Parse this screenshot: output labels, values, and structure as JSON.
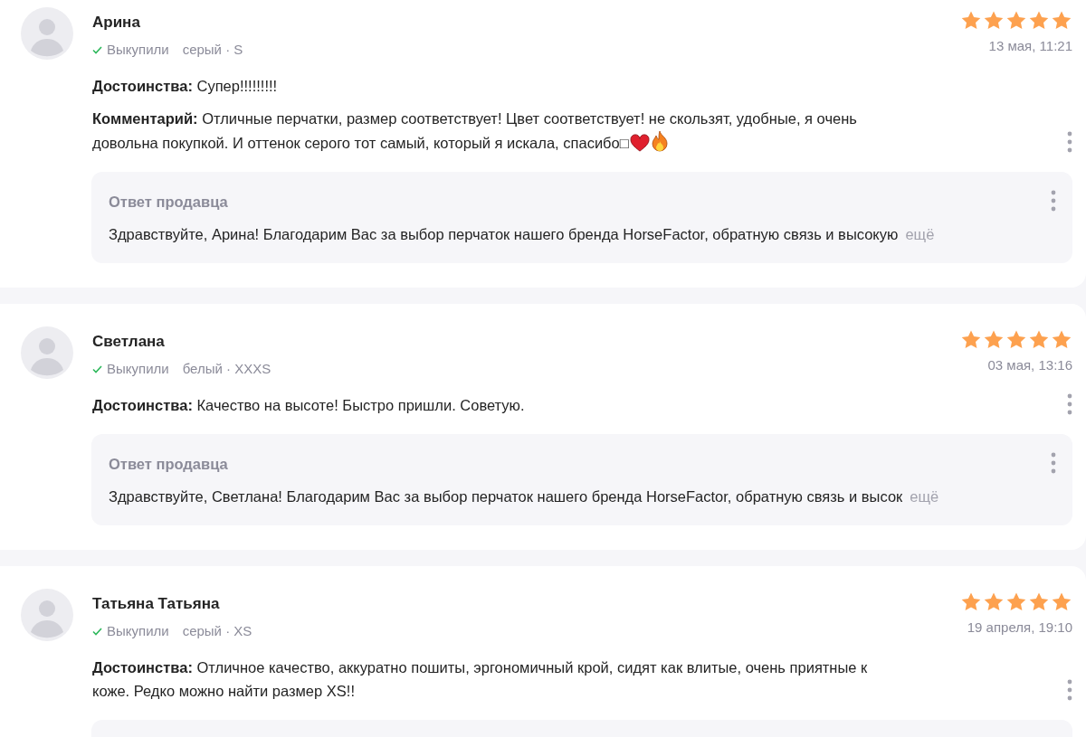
{
  "reviews": [
    {
      "author": "Арина",
      "purchase_status": "Выкупили",
      "variant": "серый · S",
      "stars": 5,
      "date": "13 мая, 11:21",
      "fields": [
        {
          "label": "Достоинства:",
          "text": "Супер!!!!!!!!!"
        },
        {
          "label": "Комментарий:",
          "text": "Отличные перчатки, размер соответствует! Цвет соответствует! не скользят, удобные, я очень довольна покупкой. И оттенок серого тот самый, который я искала, спасибо□",
          "emoji_icons": [
            {
              "kind": "heart"
            },
            {
              "kind": "fire"
            }
          ]
        }
      ],
      "reply": {
        "title": "Ответ продавца",
        "text": "Здравствуйте, Арина! Благодарим Вас за выбор перчаток нашего бренда HorseFactor, обратную связь и высокую",
        "more": "ещё"
      }
    },
    {
      "author": "Светлана",
      "purchase_status": "Выкупили",
      "variant": "белый · XXXS",
      "stars": 5,
      "date": "03 мая, 13:16",
      "fields": [
        {
          "label": "Достоинства:",
          "text": "Качество на высоте! Быстро пришли. Советую."
        }
      ],
      "reply": {
        "title": "Ответ продавца",
        "text": "Здравствуйте, Светлана! Благодарим Вас за выбор перчаток нашего бренда HorseFactor, обратную связь и высок",
        "more": "ещё"
      }
    },
    {
      "author": "Татьяна Татьяна",
      "purchase_status": "Выкупили",
      "variant": "серый · XS",
      "stars": 5,
      "date": "19 апреля, 19:10",
      "fields": [
        {
          "label": "Достоинства:",
          "text": "Отличное качество, аккуратно пошиты, эргономичный крой, сидят как влитые, очень приятные к коже. Редко можно найти размер XS!!"
        }
      ],
      "reply_panel_cut": true
    }
  ]
}
